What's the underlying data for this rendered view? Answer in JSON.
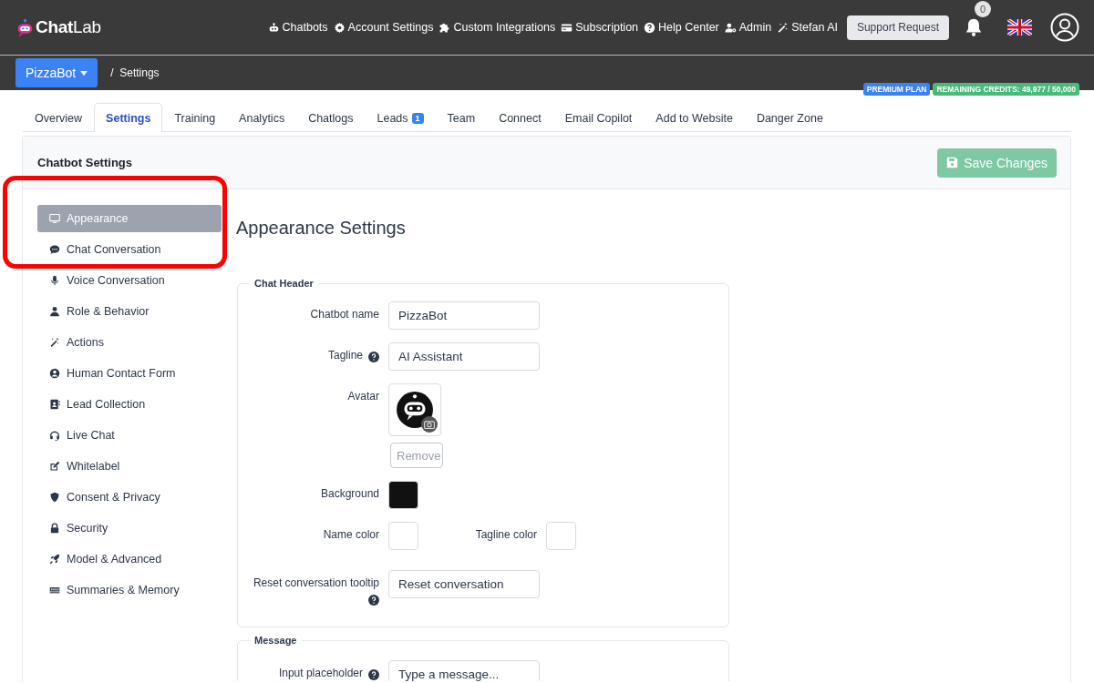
{
  "app": {
    "logo_first": "Chat",
    "logo_second": "Lab"
  },
  "nav": [
    {
      "label": "Chatbots"
    },
    {
      "label": "Account Settings"
    },
    {
      "label": "Custom Integrations"
    },
    {
      "label": "Subscription"
    },
    {
      "label": "Help Center"
    },
    {
      "label": "Admin"
    },
    {
      "label": "Stefan AI"
    }
  ],
  "support_button": "Support Request",
  "notifications": {
    "count": "0"
  },
  "breadcrumb": {
    "bot": "PizzaBot",
    "separator": "/",
    "page": "Settings"
  },
  "badges": [
    {
      "label": "PREMIUM PLAN",
      "color": "#3b82f6"
    },
    {
      "label": "REMAINING CREDITS: 49,977 / 50,000",
      "color": "#48bb78"
    }
  ],
  "tabs": [
    {
      "label": "Overview",
      "selected": false
    },
    {
      "label": "Settings",
      "selected": true
    },
    {
      "label": "Training",
      "selected": false
    },
    {
      "label": "Analytics",
      "selected": false
    },
    {
      "label": "Chatlogs",
      "selected": false
    },
    {
      "label": "Leads",
      "selected": false,
      "badge": "1"
    },
    {
      "label": "Team",
      "selected": false
    },
    {
      "label": "Connect",
      "selected": false
    },
    {
      "label": "Email Copilot",
      "selected": false
    },
    {
      "label": "Add to Website",
      "selected": false
    },
    {
      "label": "Danger Zone",
      "selected": false
    }
  ],
  "card": {
    "title": "Chatbot Settings",
    "save_button": "Save Changes"
  },
  "sidebar": {
    "items": [
      {
        "label": "Appearance",
        "selected": true
      },
      {
        "label": "Chat Conversation",
        "selected": false
      },
      {
        "label": "Voice Conversation",
        "selected": false
      },
      {
        "label": "Role & Behavior",
        "selected": false
      },
      {
        "label": "Actions",
        "selected": false
      },
      {
        "label": "Human Contact Form",
        "selected": false
      },
      {
        "label": "Lead Collection",
        "selected": false
      },
      {
        "label": "Live Chat",
        "selected": false
      },
      {
        "label": "Whitelabel",
        "selected": false
      },
      {
        "label": "Consent & Privacy",
        "selected": false
      },
      {
        "label": "Security",
        "selected": false
      },
      {
        "label": "Model & Advanced",
        "selected": false
      },
      {
        "label": "Summaries & Memory",
        "selected": false
      }
    ]
  },
  "annotation": {
    "kind": "highlight"
  },
  "section_title": "Appearance Settings",
  "fieldsets": [
    {
      "legend": "Chat Header",
      "rows": [
        {
          "kind": "text",
          "label": "Chatbot name",
          "help": false,
          "value": "PizzaBot"
        },
        {
          "kind": "text",
          "label": "Tagline",
          "help": true,
          "value": "AI Assistant"
        },
        {
          "kind": "avatar",
          "label": "Avatar",
          "button": "Remove"
        },
        {
          "kind": "color",
          "label": "Background",
          "color": "#111111"
        },
        {
          "kind": "color_pair",
          "label": "Name color",
          "color": "#ffffff",
          "extra": {
            "label": "Tagline color",
            "color": "#ffffff"
          }
        },
        {
          "kind": "text",
          "label": "Reset conversation tooltip",
          "help": true,
          "value": "Reset conversation"
        }
      ]
    },
    {
      "legend": "Message",
      "rows": [
        {
          "kind": "text",
          "label": "Input placeholder",
          "help": true,
          "value": "Type a message..."
        }
      ]
    }
  ]
}
